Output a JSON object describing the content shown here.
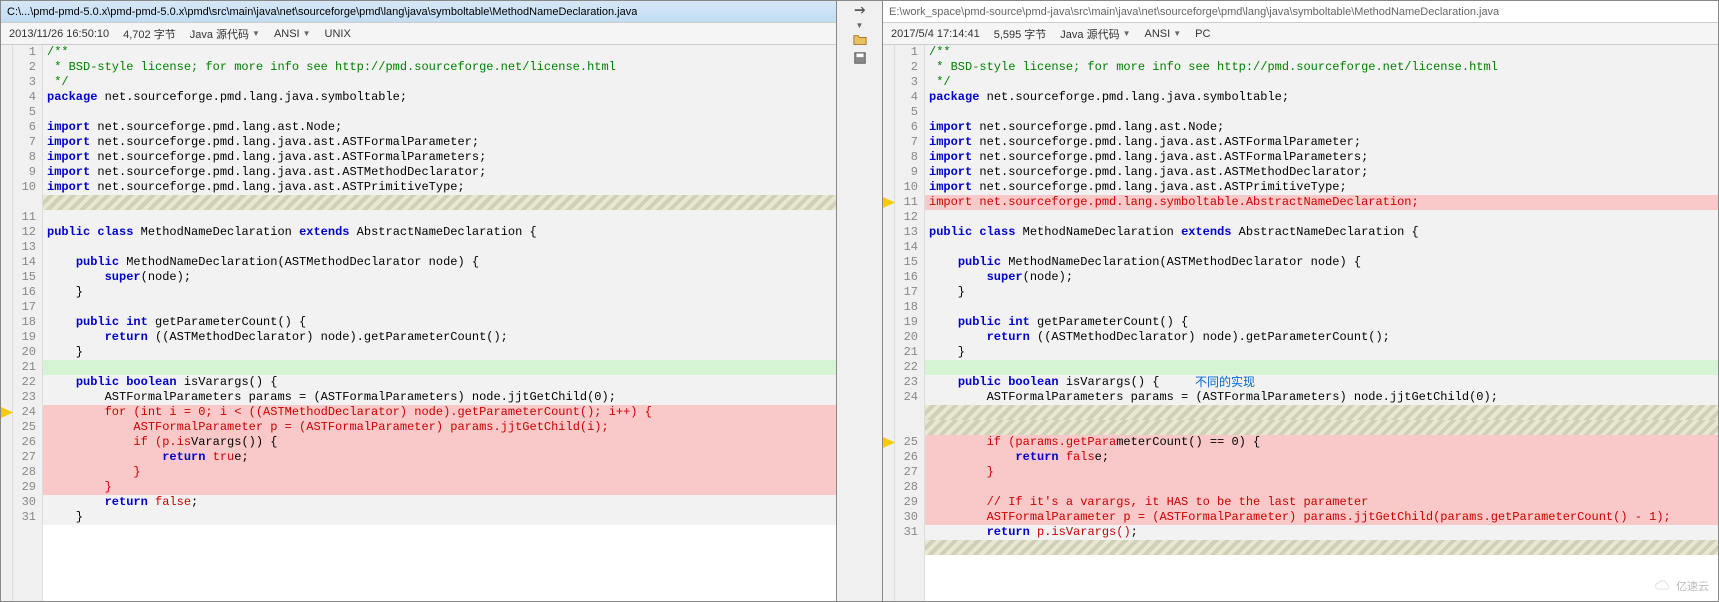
{
  "toolbar": {
    "icons": [
      "swap-arrow-icon",
      "folder-icon",
      "save-icon"
    ]
  },
  "left": {
    "path": "C:\\...\\pmd-pmd-5.0.x\\pmd-pmd-5.0.x\\pmd\\src\\main\\java\\net\\sourceforge\\pmd\\lang\\java\\symboltable\\MethodNameDeclaration.java",
    "info": {
      "date": "2013/11/26 16:50:10",
      "size": "4,702 字节",
      "lang": "Java 源代码",
      "enc": "ANSI",
      "eol": "UNIX"
    },
    "markers": [
      24
    ],
    "hatch_rows": [
      {
        "after": 10
      }
    ],
    "lines": [
      {
        "n": 1,
        "bg": "gray",
        "t": [
          [
            "cm",
            "/**"
          ]
        ]
      },
      {
        "n": 2,
        "bg": "gray",
        "t": [
          [
            "cm",
            " * BSD-style license; for more info see http://pmd.sourceforge.net/license.html"
          ]
        ]
      },
      {
        "n": 3,
        "bg": "gray",
        "t": [
          [
            "cm",
            " */"
          ]
        ]
      },
      {
        "n": 4,
        "bg": "gray",
        "t": [
          [
            "kw",
            "package"
          ],
          [
            "",
            " net.sourceforge.pmd.lang.java.symboltable;"
          ]
        ]
      },
      {
        "n": 5,
        "bg": "gray",
        "t": [
          [
            "",
            ""
          ]
        ]
      },
      {
        "n": 6,
        "bg": "gray",
        "t": [
          [
            "kw",
            "import"
          ],
          [
            "",
            " net.sourceforge.pmd.lang.ast.Node;"
          ]
        ]
      },
      {
        "n": 7,
        "bg": "gray",
        "t": [
          [
            "kw",
            "import"
          ],
          [
            "",
            " net.sourceforge.pmd.lang.java.ast.ASTFormalParameter;"
          ]
        ]
      },
      {
        "n": 8,
        "bg": "gray",
        "t": [
          [
            "kw",
            "import"
          ],
          [
            "",
            " net.sourceforge.pmd.lang.java.ast.ASTFormalParameters;"
          ]
        ]
      },
      {
        "n": 9,
        "bg": "gray",
        "t": [
          [
            "kw",
            "import"
          ],
          [
            "",
            " net.sourceforge.pmd.lang.java.ast.ASTMethodDeclarator;"
          ]
        ]
      },
      {
        "n": 10,
        "bg": "gray",
        "t": [
          [
            "kw",
            "import"
          ],
          [
            "",
            " net.sourceforge.pmd.lang.java.ast.ASTPrimitiveType;"
          ]
        ]
      },
      {
        "n": 11,
        "bg": "gray",
        "t": [
          [
            "",
            ""
          ]
        ]
      },
      {
        "n": 12,
        "bg": "gray",
        "t": [
          [
            "kw",
            "public class"
          ],
          [
            "",
            " MethodNameDeclaration "
          ],
          [
            "kw",
            "extends"
          ],
          [
            "",
            " AbstractNameDeclaration {"
          ]
        ]
      },
      {
        "n": 13,
        "bg": "gray",
        "t": [
          [
            "",
            ""
          ]
        ]
      },
      {
        "n": 14,
        "bg": "gray",
        "t": [
          [
            "",
            "    "
          ],
          [
            "kw",
            "public"
          ],
          [
            "",
            " MethodNameDeclaration(ASTMethodDeclarator node) {"
          ]
        ]
      },
      {
        "n": 15,
        "bg": "gray",
        "t": [
          [
            "",
            "        "
          ],
          [
            "kw",
            "super"
          ],
          [
            "",
            "(node);"
          ]
        ]
      },
      {
        "n": 16,
        "bg": "gray",
        "t": [
          [
            "",
            "    }"
          ]
        ]
      },
      {
        "n": 17,
        "bg": "gray",
        "t": [
          [
            "",
            ""
          ]
        ]
      },
      {
        "n": 18,
        "bg": "gray",
        "t": [
          [
            "",
            "    "
          ],
          [
            "kw",
            "public int"
          ],
          [
            "",
            " getParameterCount() {"
          ]
        ]
      },
      {
        "n": 19,
        "bg": "gray",
        "t": [
          [
            "",
            "        "
          ],
          [
            "kw",
            "return"
          ],
          [
            "",
            " ((ASTMethodDeclarator) node).getParameterCount();"
          ]
        ]
      },
      {
        "n": 20,
        "bg": "gray",
        "t": [
          [
            "",
            "    }"
          ]
        ]
      },
      {
        "n": 21,
        "bg": "green",
        "t": [
          [
            "",
            ""
          ]
        ]
      },
      {
        "n": 22,
        "bg": "gray",
        "t": [
          [
            "",
            "    "
          ],
          [
            "kw",
            "public boolean"
          ],
          [
            "",
            " isVarargs() {"
          ]
        ]
      },
      {
        "n": 23,
        "bg": "gray",
        "t": [
          [
            "",
            "        ASTFormalParameters params = (ASTFormalParameters) node.jjtGetChild("
          ],
          [
            "",
            "0"
          ],
          [
            "",
            ");"
          ]
        ]
      },
      {
        "n": 24,
        "bg": "red",
        "t": [
          [
            "",
            "        "
          ],
          [
            "diff-txt",
            "for (int i = 0; i < ((ASTMethodDeclarator) node).getParameterCount(); i++) {"
          ]
        ]
      },
      {
        "n": 25,
        "bg": "red",
        "t": [
          [
            "",
            "            "
          ],
          [
            "diff-txt",
            "ASTFormalParameter p = (ASTFormalParameter) params.jjtGetChild(i);"
          ]
        ]
      },
      {
        "n": 26,
        "bg": "red",
        "t": [
          [
            "",
            "            "
          ],
          [
            "diff-txt",
            "if (p.is"
          ],
          [
            "",
            "Varargs()) {"
          ]
        ]
      },
      {
        "n": 27,
        "bg": "red",
        "t": [
          [
            "",
            "                "
          ],
          [
            "kw",
            "return"
          ],
          [
            "diff-txt",
            " tru"
          ],
          [
            "",
            "e;"
          ]
        ]
      },
      {
        "n": 28,
        "bg": "red",
        "t": [
          [
            "",
            "            "
          ],
          [
            "diff-txt",
            "}"
          ]
        ]
      },
      {
        "n": 29,
        "bg": "red",
        "t": [
          [
            "",
            "        "
          ],
          [
            "diff-txt",
            "}"
          ]
        ]
      },
      {
        "n": 30,
        "bg": "gray",
        "t": [
          [
            "",
            "        "
          ],
          [
            "kw",
            "return"
          ],
          [
            "diff-txt",
            " false"
          ],
          [
            "",
            ";"
          ]
        ]
      },
      {
        "n": 31,
        "bg": "gray",
        "t": [
          [
            "",
            "    }"
          ]
        ]
      }
    ]
  },
  "right": {
    "path": "E:\\work_space\\pmd-source\\pmd-java\\src\\main\\java\\net\\sourceforge\\pmd\\lang\\java\\symboltable\\MethodNameDeclaration.java",
    "info": {
      "date": "2017/5/4 17:14:41",
      "size": "5,595 字节",
      "lang": "Java 源代码",
      "enc": "ANSI",
      "eol": "PC"
    },
    "note": "不同的实现",
    "markers": [
      11,
      25
    ],
    "lines": [
      {
        "n": 1,
        "bg": "gray",
        "t": [
          [
            "cm",
            "/**"
          ]
        ]
      },
      {
        "n": 2,
        "bg": "gray",
        "t": [
          [
            "cm",
            " * BSD-style license; for more info see http://pmd.sourceforge.net/license.html"
          ]
        ]
      },
      {
        "n": 3,
        "bg": "gray",
        "t": [
          [
            "cm",
            " */"
          ]
        ]
      },
      {
        "n": 4,
        "bg": "gray",
        "t": [
          [
            "kw",
            "package"
          ],
          [
            "",
            " net.sourceforge.pmd.lang.java.symboltable;"
          ]
        ]
      },
      {
        "n": 5,
        "bg": "gray",
        "t": [
          [
            "",
            ""
          ]
        ]
      },
      {
        "n": 6,
        "bg": "gray",
        "t": [
          [
            "kw",
            "import"
          ],
          [
            "",
            " net.sourceforge.pmd.lang.ast.Node;"
          ]
        ]
      },
      {
        "n": 7,
        "bg": "gray",
        "t": [
          [
            "kw",
            "import"
          ],
          [
            "",
            " net.sourceforge.pmd.lang.java.ast.ASTFormalParameter;"
          ]
        ]
      },
      {
        "n": 8,
        "bg": "gray",
        "t": [
          [
            "kw",
            "import"
          ],
          [
            "",
            " net.sourceforge.pmd.lang.java.ast.ASTFormalParameters;"
          ]
        ]
      },
      {
        "n": 9,
        "bg": "gray",
        "t": [
          [
            "kw",
            "import"
          ],
          [
            "",
            " net.sourceforge.pmd.lang.java.ast.ASTMethodDeclarator;"
          ]
        ]
      },
      {
        "n": 10,
        "bg": "gray",
        "t": [
          [
            "kw",
            "import"
          ],
          [
            "",
            " net.sourceforge.pmd.lang.java.ast.ASTPrimitiveType;"
          ]
        ]
      },
      {
        "n": 11,
        "bg": "red",
        "t": [
          [
            "diff-txt",
            "import net.sourceforge.pmd.lang.symboltable.AbstractNameDeclaration;"
          ]
        ]
      },
      {
        "n": 12,
        "bg": "gray",
        "t": [
          [
            "",
            ""
          ]
        ]
      },
      {
        "n": 13,
        "bg": "gray",
        "t": [
          [
            "kw",
            "public class"
          ],
          [
            "",
            " MethodNameDeclaration "
          ],
          [
            "kw",
            "extends"
          ],
          [
            "",
            " AbstractNameDeclaration {"
          ]
        ]
      },
      {
        "n": 14,
        "bg": "gray",
        "t": [
          [
            "",
            ""
          ]
        ]
      },
      {
        "n": 15,
        "bg": "gray",
        "t": [
          [
            "",
            "    "
          ],
          [
            "kw",
            "public"
          ],
          [
            "",
            " MethodNameDeclaration(ASTMethodDeclarator node) {"
          ]
        ]
      },
      {
        "n": 16,
        "bg": "gray",
        "t": [
          [
            "",
            "        "
          ],
          [
            "kw",
            "super"
          ],
          [
            "",
            "(node);"
          ]
        ]
      },
      {
        "n": 17,
        "bg": "gray",
        "t": [
          [
            "",
            "    }"
          ]
        ]
      },
      {
        "n": 18,
        "bg": "gray",
        "t": [
          [
            "",
            ""
          ]
        ]
      },
      {
        "n": 19,
        "bg": "gray",
        "t": [
          [
            "",
            "    "
          ],
          [
            "kw",
            "public int"
          ],
          [
            "",
            " getParameterCount() {"
          ]
        ]
      },
      {
        "n": 20,
        "bg": "gray",
        "t": [
          [
            "",
            "        "
          ],
          [
            "kw",
            "return"
          ],
          [
            "",
            " ((ASTMethodDeclarator) node).getParameterCount();"
          ]
        ]
      },
      {
        "n": 21,
        "bg": "gray",
        "t": [
          [
            "",
            "    }"
          ]
        ]
      },
      {
        "n": 22,
        "bg": "green",
        "t": [
          [
            "",
            ""
          ]
        ]
      },
      {
        "n": 23,
        "bg": "gray",
        "t": [
          [
            "",
            "    "
          ],
          [
            "kw",
            "public boolean"
          ],
          [
            "",
            " isVarargs() {"
          ]
        ]
      },
      {
        "n": 24,
        "bg": "gray",
        "t": [
          [
            "",
            "        ASTFormalParameters params = (ASTFormalParameters) node.jjtGetChild("
          ],
          [
            "",
            "0"
          ],
          [
            "",
            ");"
          ]
        ]
      },
      {
        "n": 25,
        "bg": "red",
        "t": [
          [
            "",
            "        "
          ],
          [
            "diff-txt",
            "if (params.getPara"
          ],
          [
            "",
            "meterCount() == 0) {"
          ]
        ]
      },
      {
        "n": 26,
        "bg": "red",
        "t": [
          [
            "",
            "            "
          ],
          [
            "kw",
            "return"
          ],
          [
            "diff-txt",
            " fals"
          ],
          [
            "",
            "e;"
          ]
        ]
      },
      {
        "n": 27,
        "bg": "red",
        "t": [
          [
            "",
            "        "
          ],
          [
            "diff-txt",
            "}"
          ]
        ]
      },
      {
        "n": 28,
        "bg": "red",
        "t": [
          [
            "",
            ""
          ]
        ]
      },
      {
        "n": 29,
        "bg": "red",
        "t": [
          [
            "",
            "        "
          ],
          [
            "diff-txt",
            "// If it's a varargs, it HAS to be the last parameter"
          ]
        ]
      },
      {
        "n": 30,
        "bg": "red",
        "t": [
          [
            "",
            "        "
          ],
          [
            "diff-txt",
            "ASTFormalParameter p = (ASTFormalParameter) params.jjtGetChild(params.getParameterCount() - 1);"
          ]
        ]
      },
      {
        "n": 31,
        "bg": "gray",
        "t": [
          [
            "",
            "        "
          ],
          [
            "kw",
            "return"
          ],
          [
            "diff-txt",
            " p.isVarargs()"
          ],
          [
            "",
            ";"
          ]
        ]
      }
    ],
    "hatch_rows": [
      {
        "before": 25,
        "count": 2
      },
      {
        "after": 31
      }
    ]
  },
  "watermark": "亿速云"
}
